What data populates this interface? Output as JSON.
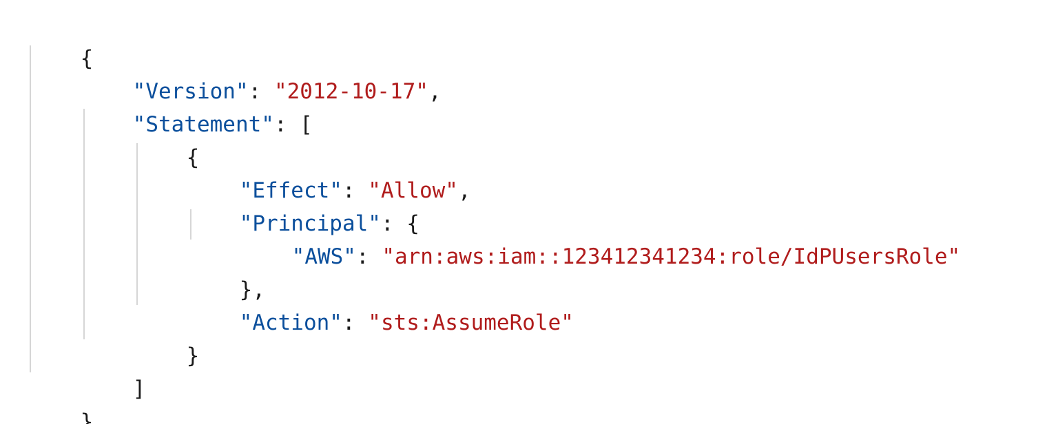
{
  "colors": {
    "key": "#0b4f9c",
    "string": "#b01c1c",
    "punctuation": "#1a1a1a",
    "indent_guide": "#d6d6d6",
    "background": "#ffffff"
  },
  "policy": {
    "open_brace": "{",
    "close_brace": "}",
    "version_key": "\"Version\"",
    "version_value": "\"2012-10-17\"",
    "statement_key": "\"Statement\"",
    "statement_open": "[",
    "statement_close": "]",
    "statement": {
      "open_brace": "{",
      "close_brace": "}",
      "effect_key": "\"Effect\"",
      "effect_value": "\"Allow\"",
      "principal_key": "\"Principal\"",
      "principal_open": "{",
      "principal_close": "},",
      "aws_key": "\"AWS\"",
      "aws_value": "\"arn:aws:iam::123412341234:role/IdPUsersRole\"",
      "action_key": "\"Action\"",
      "action_value": "\"sts:AssumeRole\""
    }
  },
  "punctuation": {
    "colon": ": ",
    "comma": ","
  }
}
